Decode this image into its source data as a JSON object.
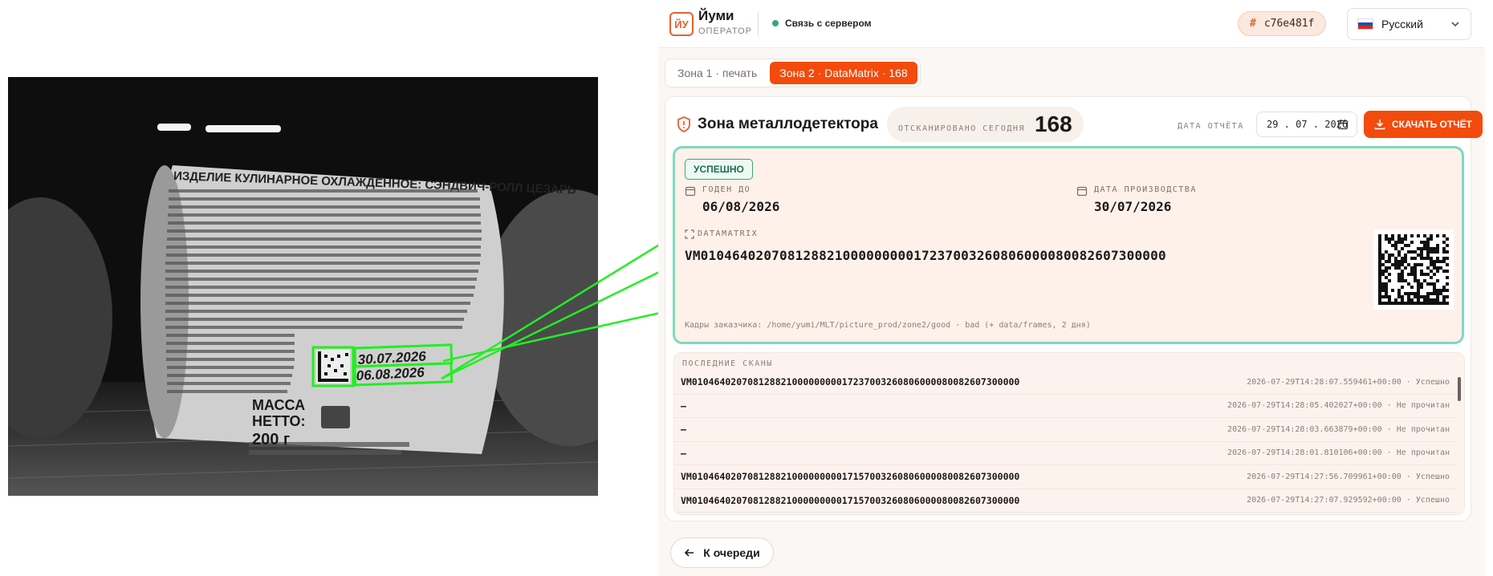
{
  "camera": {
    "label_heading": "ИЗДЕЛИЕ КУЛИНАРНОЕ ОХЛАЖДЕННОЕ: СЭНДВИЧ-РОЛЛ ЦЕЗАРЬ",
    "date_1": "30.07.2026",
    "date_2": "06.08.2026",
    "mass_label": "МАССА\nНЕТТО:",
    "mass_value": "200 г"
  },
  "header": {
    "logo_text": "ЙУ",
    "app_name": "Йуми",
    "role": "ОПЕРАТОР",
    "connection": "Связь с сервером",
    "session_hash_symbol": "#",
    "session_id": "c76e481f",
    "language": "Русский"
  },
  "tabs": [
    {
      "label": "Зона 1 · печать",
      "active": false
    },
    {
      "label": "Зона 2 · DataMatrix · 168",
      "active": true
    }
  ],
  "zone": {
    "title": "Зона металлодетектора",
    "scanned_label": "ОТСКАНИРОВАНО СЕГОДНЯ",
    "scanned_count": "168",
    "report_date_label": "ДАТА ОТЧЁТА",
    "report_date": "29 . 07 . 2026",
    "download_label": "СКАЧАТЬ ОТЧЁТ"
  },
  "result": {
    "status": "УСПЕШНО",
    "expiry_label": "ГОДЕН ДО",
    "expiry_value": "06/08/2026",
    "production_label": "ДАТА ПРОИЗВОДСТВА",
    "production_value": "30/07/2026",
    "datamatrix_label": "DATAMATRIX",
    "datamatrix_value": "VM01046402070812882100000000017237003260806000080082607300000",
    "frames_note": "Кадры заказчика: /home/yumi/MLT/picture_prod/zone2/good · bad (+ data/frames, 2 дня)"
  },
  "scans": {
    "title": "ПОСЛЕДНИЕ СКАНЫ",
    "rows": [
      {
        "code": "VM01046402070812882100000000017237003260806000080082607300000",
        "meta": "2026-07-29T14:28:07.559461+00:00 · Успешно"
      },
      {
        "code": "—",
        "meta": "2026-07-29T14:28:05.402027+00:00 · Не прочитан"
      },
      {
        "code": "—",
        "meta": "2026-07-29T14:28:03.663879+00:00 · Не прочитан"
      },
      {
        "code": "—",
        "meta": "2026-07-29T14:28:01.810106+00:00 · Не прочитан"
      },
      {
        "code": "VM01046402070812882100000000017157003260806000080082607300000",
        "meta": "2026-07-29T14:27:56.709961+00:00 · Успешно"
      },
      {
        "code": "VM01046402070812882100000000017157003260806000080082607300000",
        "meta": "2026-07-29T14:27:07.929592+00:00 · Успешно"
      }
    ]
  },
  "footer": {
    "back_label": "К очереди"
  },
  "colors": {
    "accent": "#f24b0c",
    "success_border": "#7ed9bd",
    "detection_green": "#22ee22"
  }
}
